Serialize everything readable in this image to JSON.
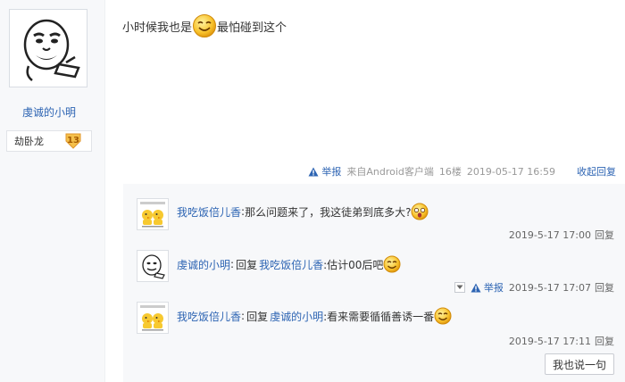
{
  "author": {
    "name": "虔诚的小明",
    "level_title": "劫卧龙",
    "level_number": "13"
  },
  "post": {
    "text_before": "小时候我也是",
    "text_after": "最怕碰到这个",
    "report_label": "举报",
    "source": "来自Android客户端",
    "floor": "16楼",
    "datetime": "2019-05-17 16:59",
    "collapse_label": "收起回复"
  },
  "replies": [
    {
      "user": "我吃饭倍儿香",
      "separator": ":",
      "text": "那么问题来了，我这徒弟到底多大?",
      "time": "2019-5-17 17:00",
      "reply_label": "回复"
    },
    {
      "user": "虔诚的小明",
      "separator": ":",
      "reply_word": "回复",
      "target_user": "我吃饭倍儿香",
      "text": ":估计00后吧",
      "report_label": "举报",
      "time": "2019-5-17 17:07",
      "reply_label": "回复"
    },
    {
      "user": "我吃饭倍儿香",
      "separator": ":",
      "reply_word": "回复",
      "target_user": "虔诚的小明",
      "text": ":看来需要循循善诱一番",
      "time": "2019-5-17 17:11",
      "reply_label": "回复"
    }
  ],
  "say_button_label": "我也说一句",
  "colors": {
    "link": "#2d64b3",
    "reply_bg": "#f7f8fa",
    "badge": "#f5c04a"
  },
  "icons": [
    "meme-face-avatar",
    "smile-emoji-icon",
    "crying-emoji-icon",
    "warning-triangle-icon",
    "level-badge-icon",
    "chevron-down-icon",
    "duck-meme-avatar"
  ]
}
